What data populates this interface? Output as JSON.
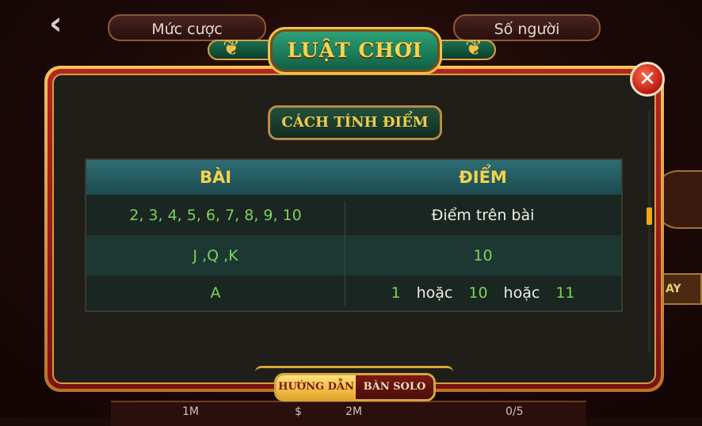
{
  "top_tabs": {
    "left": "Mức cược",
    "right": "Số người"
  },
  "bottom_strip": {
    "a": "1M",
    "b": "$",
    "c": "2M",
    "d": "0/5"
  },
  "side_button": "AY",
  "modal": {
    "title": "LUẬT CHƠI",
    "section": "CÁCH TÍNH ĐIỂM",
    "table": {
      "headers": [
        "BÀI",
        "ĐIỂM"
      ],
      "rows": [
        {
          "card": "2, 3, 4, 5, 6, 7, 8, 9, 10",
          "points": "Điểm trên bài"
        },
        {
          "card": "J ,Q ,K",
          "points": "10"
        },
        {
          "card": "A",
          "points": [
            "1",
            "hoặc",
            "10",
            "hoặc",
            "11"
          ]
        }
      ]
    },
    "tabs": {
      "active": "HƯỚNG DẪN",
      "inactive": "BÀN SOLO"
    }
  },
  "colors": {
    "accent_gold": "#f2c14a",
    "frame_red": "#b3271d",
    "value_green": "#7fd05a"
  }
}
